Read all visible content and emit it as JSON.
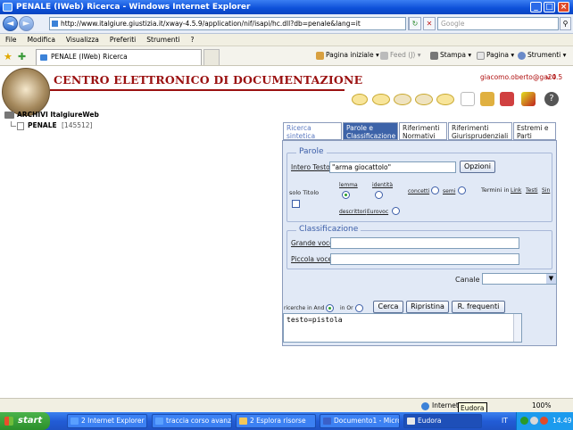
{
  "window": {
    "title": "PENALE (IWeb) Ricerca - Windows Internet Explorer"
  },
  "address": {
    "url": "http://www.italgiure.giustizia.it/xway-4.5.9/application/nif/isapi/hc.dll?db=penale&lang=it",
    "search_placeholder": "Google"
  },
  "menu": [
    "File",
    "Modifica",
    "Visualizza",
    "Preferiti",
    "Strumenti",
    "?"
  ],
  "tab": {
    "label": "PENALE (IWeb) Ricerca"
  },
  "commands": {
    "home": "Pagina iniziale",
    "feed": "Feed (J)",
    "print": "Stampa",
    "page": "Pagina",
    "tools": "Strumenti"
  },
  "header": {
    "title": "CENTRO ELETTRONICO DI DOCUMENTAZIONE",
    "user": "giacomo.oberto@ga20",
    "version": "v.4.5"
  },
  "tree": {
    "root": "ARCHIVI ItalgiureWeb",
    "item": "PENALE",
    "count": "[145512]"
  },
  "tabs": [
    "Ricerca sintetica",
    "Parole e Classificazione",
    "Riferimenti Normativi",
    "Riferimenti Giurisprudenziali",
    "Estremi e Parti"
  ],
  "parole": {
    "legend": "Parole",
    "intero_testo_label": "Intero Testo",
    "intero_testo_value": "\"arma giocattolo\"",
    "opzioni": "Opzioni",
    "solo_titolo": "solo Titolo",
    "lemma": "lemma",
    "identita": "identità",
    "concetti": "concetti",
    "semi": "semi",
    "termini_in": "Termini in",
    "link": "Link",
    "testi": "Testi",
    "sin": "Sin",
    "descrittori": "descrittori",
    "eurovoc": "Eurovoc"
  },
  "classificazione": {
    "legend": "Classificazione",
    "grande": "Grande voce",
    "piccola": "Piccola voce",
    "canale": "Canale"
  },
  "ricerca": {
    "and_label": "ricerche in And",
    "or_label": "in Or",
    "cerca": "Cerca",
    "ripristina": "Ripristina",
    "frequenti": "R. frequenti",
    "query": "testo=pistola"
  },
  "status": {
    "zone": "Internet",
    "zoom": "100%"
  },
  "tooltip": "Eudora",
  "taskbar": {
    "start": "start",
    "items": [
      "2 Internet Explorer",
      "traccia corso avanz...",
      "2 Esplora risorse",
      "Documento1 - Micro...",
      "Eudora"
    ],
    "lang": "IT",
    "time": "14.49"
  }
}
